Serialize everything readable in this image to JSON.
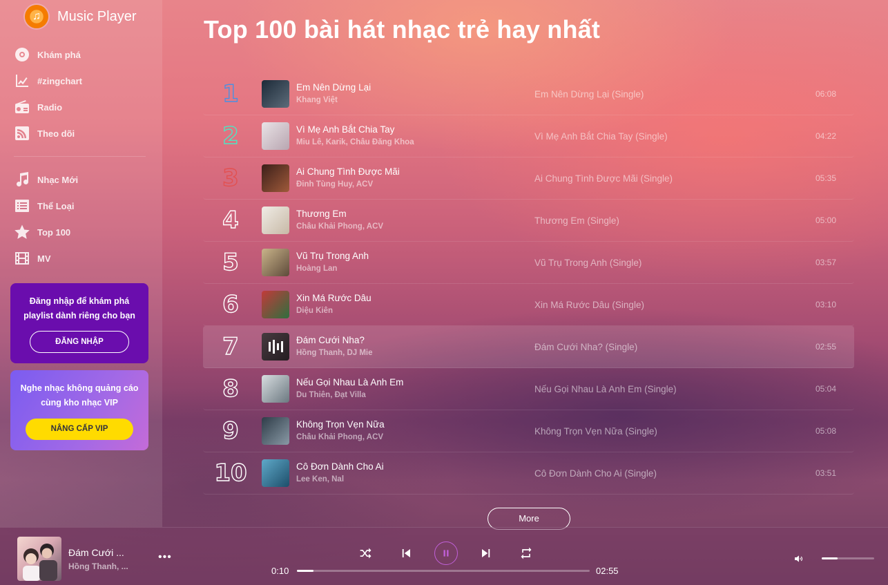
{
  "app": {
    "title": "Music Player"
  },
  "sidebar": {
    "items_top": [
      {
        "label": "Khám phá",
        "icon": "disc-icon"
      },
      {
        "label": "#zingchart",
        "icon": "chart-line-icon"
      },
      {
        "label": "Radio",
        "icon": "radio-icon"
      },
      {
        "label": "Theo dõi",
        "icon": "rss-icon"
      }
    ],
    "items_bottom": [
      {
        "label": "Nhạc Mới",
        "icon": "music-note-icon"
      },
      {
        "label": "Thể Loại",
        "icon": "list-icon"
      },
      {
        "label": "Top 100",
        "icon": "star-icon"
      },
      {
        "label": "MV",
        "icon": "film-icon"
      }
    ],
    "login_promo": {
      "text": "Đăng nhập để khám phá playlist dành riêng cho bạn",
      "button": "ĐĂNG NHẬP",
      "color": "#6a0dad"
    },
    "vip_promo": {
      "text": "Nghe nhạc không quảng cáo cùng kho nhạc VIP",
      "button": "NÂNG CẤP VIP",
      "button_color": "#ffdb00"
    }
  },
  "main": {
    "title": "Top 100 bài hát nhạc trẻ hay nhất",
    "songs": [
      {
        "rank": "1",
        "title": "Em Nên Dừng Lại",
        "artist": "Khang Việt",
        "album": "Em Nên Dừng Lại (Single)",
        "duration": "06:08",
        "rank_color": "#4a90e2",
        "thumb": [
          "#1c2a38",
          "#5d6c7a"
        ]
      },
      {
        "rank": "2",
        "title": "Vì Mẹ Anh Bắt Chia Tay",
        "artist": "Miu Lê, Karik, Châu Đăng Khoa",
        "album": "Vì Mẹ Anh Bắt Chia Tay (Single)",
        "duration": "04:22",
        "rank_color": "#50e3c2",
        "thumb": [
          "#e9e3e6",
          "#b8a5b0"
        ]
      },
      {
        "rank": "3",
        "title": "Ai Chung Tình Được Mãi",
        "artist": "Đinh Tùng Huy, ACV",
        "album": "Ai Chung Tình Được Mãi (Single)",
        "duration": "05:35",
        "rank_color": "#e35050",
        "thumb": [
          "#3b1f1a",
          "#a05a3a"
        ]
      },
      {
        "rank": "4",
        "title": "Thương Em",
        "artist": "Châu Khải Phong, ACV",
        "album": "Thương Em (Single)",
        "duration": "05:00",
        "rank_color": "#ffffff",
        "thumb": [
          "#f0ece6",
          "#c7b9a6"
        ]
      },
      {
        "rank": "5",
        "title": "Vũ Trụ Trong Anh",
        "artist": "Hoàng Lan",
        "album": "Vũ Trụ Trong Anh (Single)",
        "duration": "03:57",
        "rank_color": "#ffffff",
        "thumb": [
          "#c9b48a",
          "#5e4a3a"
        ]
      },
      {
        "rank": "6",
        "title": "Xin Má Rước Dâu",
        "artist": "Diệu Kiên",
        "album": "Xin Má Rước Dâu (Single)",
        "duration": "03:10",
        "rank_color": "#ffffff",
        "thumb": [
          "#c23a3a",
          "#2f6f3e"
        ]
      },
      {
        "rank": "7",
        "title": "Đám Cưới Nha?",
        "artist": "Hồng Thanh, DJ Mie",
        "album": "Đám Cưới Nha? (Single)",
        "duration": "02:55",
        "rank_color": "#ffffff",
        "thumb": [
          "#6d5a62",
          "#3a2e34"
        ],
        "active": true
      },
      {
        "rank": "8",
        "title": "Nếu Gọi Nhau Là Anh Em",
        "artist": "Du Thiên, Đạt Villa",
        "album": "Nếu Gọi Nhau Là Anh Em (Single)",
        "duration": "05:04",
        "rank_color": "#ffffff",
        "thumb": [
          "#d8dde0",
          "#6b7880"
        ]
      },
      {
        "rank": "9",
        "title": "Không Trọn Vẹn Nữa",
        "artist": "Châu Khải Phong, ACV",
        "album": "Không Trọn Vẹn Nữa (Single)",
        "duration": "05:08",
        "rank_color": "#ffffff",
        "thumb": [
          "#2e3c48",
          "#8a9aa6"
        ]
      },
      {
        "rank": "10",
        "title": "Cô Đơn Dành Cho Ai",
        "artist": "Lee Ken, Nal",
        "album": "Cô Đơn Dành Cho Ai (Single)",
        "duration": "03:51",
        "rank_color": "#ffffff",
        "thumb": [
          "#5fa9c9",
          "#1d4e6a"
        ]
      }
    ],
    "more_label": "More"
  },
  "player": {
    "title": "Đám Cưới ...",
    "artist": "Hồng Thanh, ...",
    "more_icon": "more-dots-icon",
    "current_time": "0:10",
    "total_time": "02:55",
    "progress_fraction": 0.057,
    "volume_fraction": 0.3
  }
}
